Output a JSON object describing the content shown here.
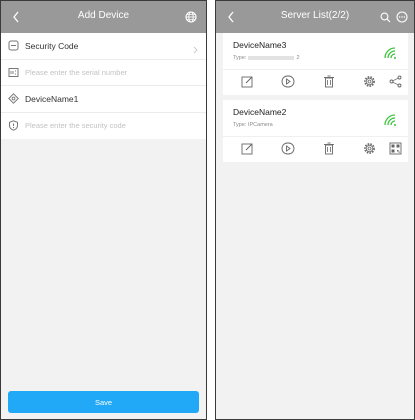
{
  "add_device": {
    "title": "Add Device",
    "rows": [
      {
        "label": "Security Code",
        "icon": "code-scan-icon"
      },
      {
        "placeholder": "Please enter the serial number",
        "icon": "serial-icon"
      },
      {
        "label": "DeviceName1",
        "icon": "device-name-icon"
      },
      {
        "placeholder": "Please enter the security code",
        "icon": "shield-icon"
      }
    ],
    "save_label": "Save"
  },
  "server_list": {
    "title": "Server List(2/2)",
    "devices": [
      {
        "name": "DeviceName3",
        "type_prefix": "Type:",
        "type_suffix": "2"
      },
      {
        "name": "DeviceName2",
        "type_prefix": "Type:",
        "type_value": "IPCamera"
      }
    ]
  },
  "colors": {
    "nav": "#999999",
    "accent": "#21a8f6",
    "wifi": "#3ec43e"
  }
}
